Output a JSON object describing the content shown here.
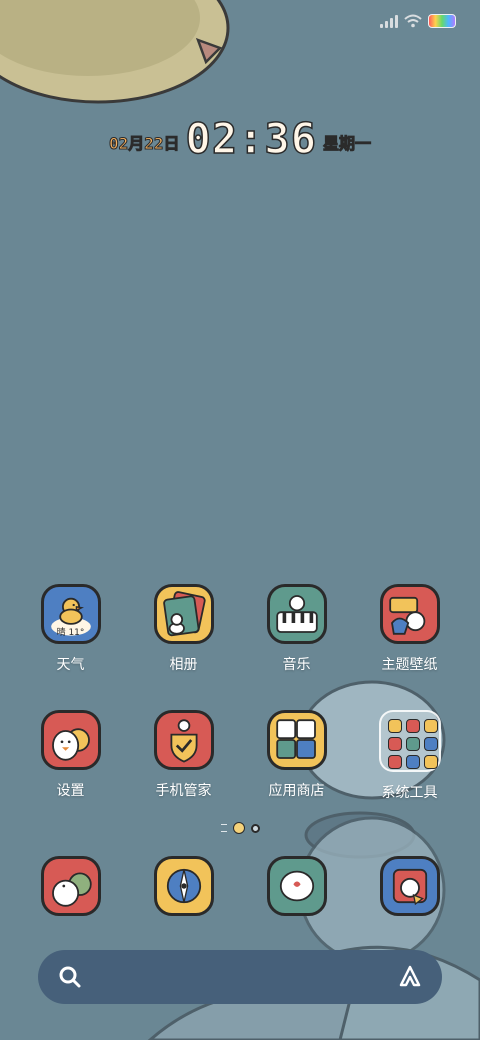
{
  "status_bar": {
    "signal_icon": "signal-icon",
    "wifi_icon": "wifi-icon",
    "battery_icon": "battery-icon"
  },
  "clock": {
    "date": "02月22日",
    "time": "02:36",
    "weekday": "星期一"
  },
  "rows": [
    [
      {
        "label": "天气",
        "icon": "weather-duck-icon",
        "bg": "#4e7fc2",
        "weather_text": "晴 11°"
      },
      {
        "label": "相册",
        "icon": "gallery-duck-icon",
        "bg": "#f2c35a"
      },
      {
        "label": "音乐",
        "icon": "music-duck-icon",
        "bg": "#5f9a8d"
      },
      {
        "label": "主题壁纸",
        "icon": "theme-duck-icon",
        "bg": "#d75a55"
      }
    ],
    [
      {
        "label": "设置",
        "icon": "settings-duck-icon",
        "bg": "#d75a55"
      },
      {
        "label": "手机管家",
        "icon": "security-duck-icon",
        "bg": "#d75a55"
      },
      {
        "label": "应用商店",
        "icon": "app-store-duck-icon",
        "bg": "#f2c35a"
      },
      {
        "label": "系统工具",
        "icon": "folder-icon"
      }
    ]
  ],
  "dock": [
    {
      "icon": "phone-duck-icon",
      "bg": "#d75a55"
    },
    {
      "icon": "browser-duck-icon",
      "bg": "#f2c35a"
    },
    {
      "icon": "messages-duck-icon",
      "bg": "#5f9a8d"
    },
    {
      "icon": "camera-duck-icon",
      "bg": "#4e7fc2"
    }
  ],
  "folder_colors": [
    "#f2c35a",
    "#d75a55",
    "#f2c35a",
    "#d75a55",
    "#5f9a8d",
    "#4e7fc2",
    "#d75a55",
    "#4e7fc2",
    "#f2c35a"
  ],
  "colors": {
    "wallpaper": "#6a8794",
    "dock_search": "#46607a",
    "label": "#ffffff"
  },
  "search": {
    "search_icon": "search-icon",
    "assistant_icon": "assistant-icon"
  }
}
